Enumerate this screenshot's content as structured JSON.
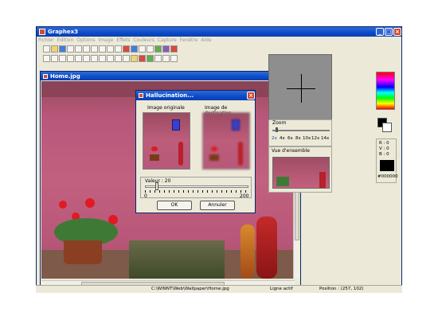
{
  "app": {
    "title": "Graphex3",
    "menu": [
      "Fichier",
      "Edition",
      "Options",
      "Image",
      "Effets",
      "Couleurs",
      "Capture",
      "Fenêtre",
      "Aide"
    ]
  },
  "document": {
    "title": "Home.jpg"
  },
  "dialog": {
    "title": "Hallucination...",
    "original_label": "Image originale",
    "destination_label": "Image de destination",
    "value_label": "Valeur : 20",
    "value": 20,
    "min_label": "0",
    "max_label": "200",
    "ok_label": "OK",
    "cancel_label": "Annuler"
  },
  "zoom": {
    "label": "Zoom",
    "levels": [
      "2x",
      "4x",
      "6x",
      "8x",
      "10x",
      "12x",
      "14x"
    ]
  },
  "overview": {
    "label": "Vue d'ensemble"
  },
  "color": {
    "r": "R : 0",
    "v": "V : 0",
    "b": "B : 0",
    "hex": "#000000",
    "current": "#000000"
  },
  "status": {
    "path": "C:\\WINNT\\Web\\Wallpaper\\Home.jpg",
    "mode": "Ligne actif",
    "position": "Position : (257, 102)"
  }
}
